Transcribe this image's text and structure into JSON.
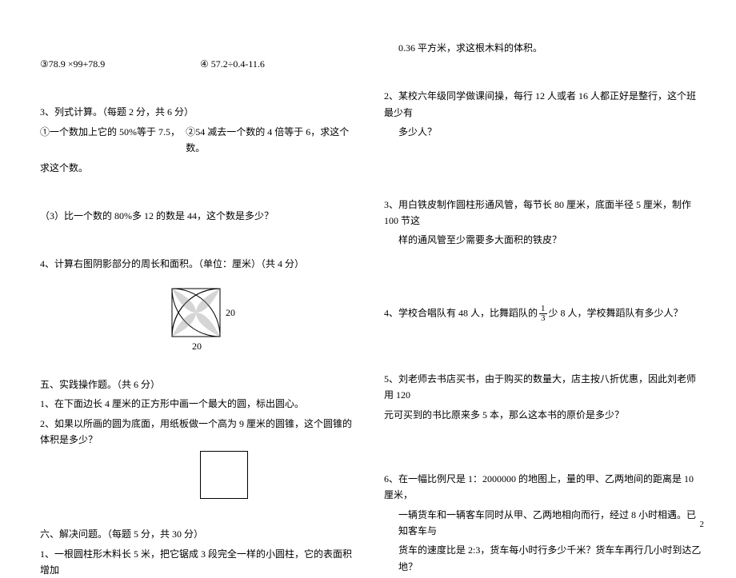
{
  "left": {
    "ex_pair_top": {
      "a": "③78.9 ×99+78.9",
      "b": "④ 57.2÷0.4-11.6"
    },
    "sec3_title": "3、列式计算。（每题 2 分，共 6 分）",
    "sec3_pair": {
      "a": "①一个数加上它的 50%等于 7.5，",
      "b": "②54 减去一个数的 4 倍等于 6，求这个数。"
    },
    "sec3_follow": "求这个数。",
    "sec3_q3": "（3）比一个数的 80%多 12 的数是 44，这个数是多少？",
    "sec4_title": "4、计算右图阴影部分的周长和面积。（单位：厘米）（共 4 分）",
    "fig4": {
      "label_right": "20",
      "label_bottom": "20"
    },
    "sec5_title": "五、实践操作题。（共 6 分）",
    "sec5_q1": "1、在下面边长 4 厘米的正方形中画一个最大的圆，标出圆心。",
    "sec5_q2": "2、如果以所画的圆为底面，用纸板做一个高为 9 厘米的圆锥，这个圆锥的体积是多少？",
    "sec6_title": "六、解决问题。（每题 5 分，共 30 分）",
    "sec6_q1": "1、一根圆柱形木料长 5 米，把它锯成 3 段完全一样的小圆柱，它的表面积增加"
  },
  "right": {
    "q1_cont": "0.36 平方米，求这根木料的体积。",
    "q2_a": "2、某校六年级同学做课间操，每行 12 人或者 16 人都正好是整行，这个班最少有",
    "q2_b": "多少人？",
    "q3_a": "3、用白铁皮制作圆柱形通风管，每节长 80 厘米，底面半径 5 厘米，制作 100 节这",
    "q3_b": "样的通风管至少需要多大面积的铁皮？",
    "q4_a": "4、学校合唱队有 48 人，比舞蹈队的",
    "q4_frac": {
      "num": "1",
      "den": "3"
    },
    "q4_b": "少 8 人，学校舞蹈队有多少人？",
    "q5_a": "5、刘老师去书店买书，由于购买的数量大，店主按八折优惠，因此刘老师用 120",
    "q5_b": "元可买到的书比原来多 5 本，那么这本书的原价是多少？",
    "q6_a": "6、在一幅比例尺是 1：2000000 的地图上，量的甲、乙两地间的距离是 10 厘米，",
    "q6_b": "一辆货车和一辆客车同时从甲、乙两地相向而行，经过 8 小时相遇。已知客车与",
    "q6_c": "货车的速度比是 2:3，货车每小时行多少千米？货车车再行几小时到达乙地？"
  },
  "page_number": "2"
}
